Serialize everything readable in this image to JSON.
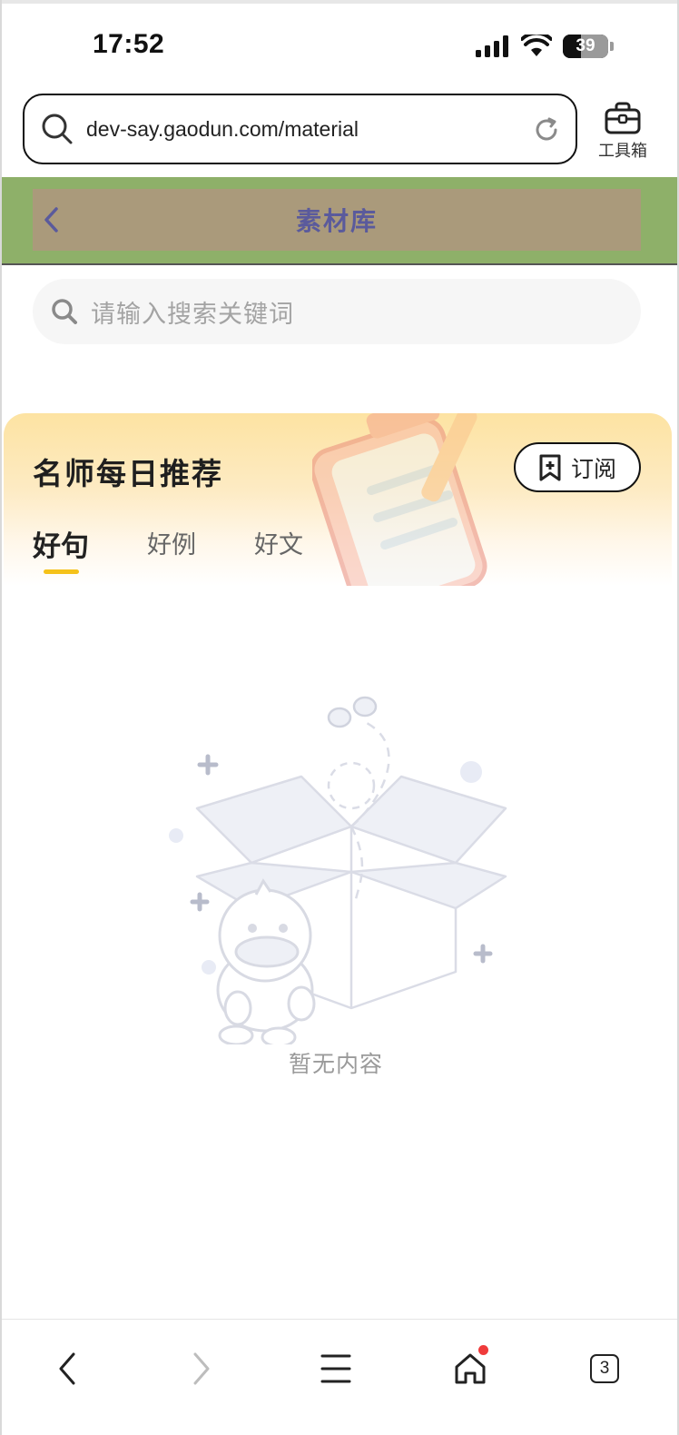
{
  "status": {
    "time": "17:52",
    "battery": "39"
  },
  "browser": {
    "url": "dev-say.gaodun.com/material",
    "toolbox_label": "工具箱",
    "tab_count": "3"
  },
  "nav": {
    "title": "素材库"
  },
  "search": {
    "placeholder": "请输入搜索关键词"
  },
  "card": {
    "title": "名师每日推荐",
    "subscribe_label": "订阅",
    "tabs": [
      {
        "label": "好句",
        "active": true
      },
      {
        "label": "好例",
        "active": false
      },
      {
        "label": "好文",
        "active": false
      }
    ]
  },
  "empty": {
    "text": "暂无内容"
  },
  "colors": {
    "nav_bg": "#8eb069",
    "nav_inner": "#aa9a7b",
    "nav_title": "#5a5a9c",
    "tab_indicator": "#f5c21a",
    "notif_dot": "#ef3b3b"
  },
  "icons": [
    "search-icon",
    "reload-icon",
    "toolbox-icon",
    "back-icon",
    "bookmark-plus-icon",
    "chevron-left-icon",
    "chevron-right-icon",
    "menu-icon",
    "home-icon"
  ]
}
